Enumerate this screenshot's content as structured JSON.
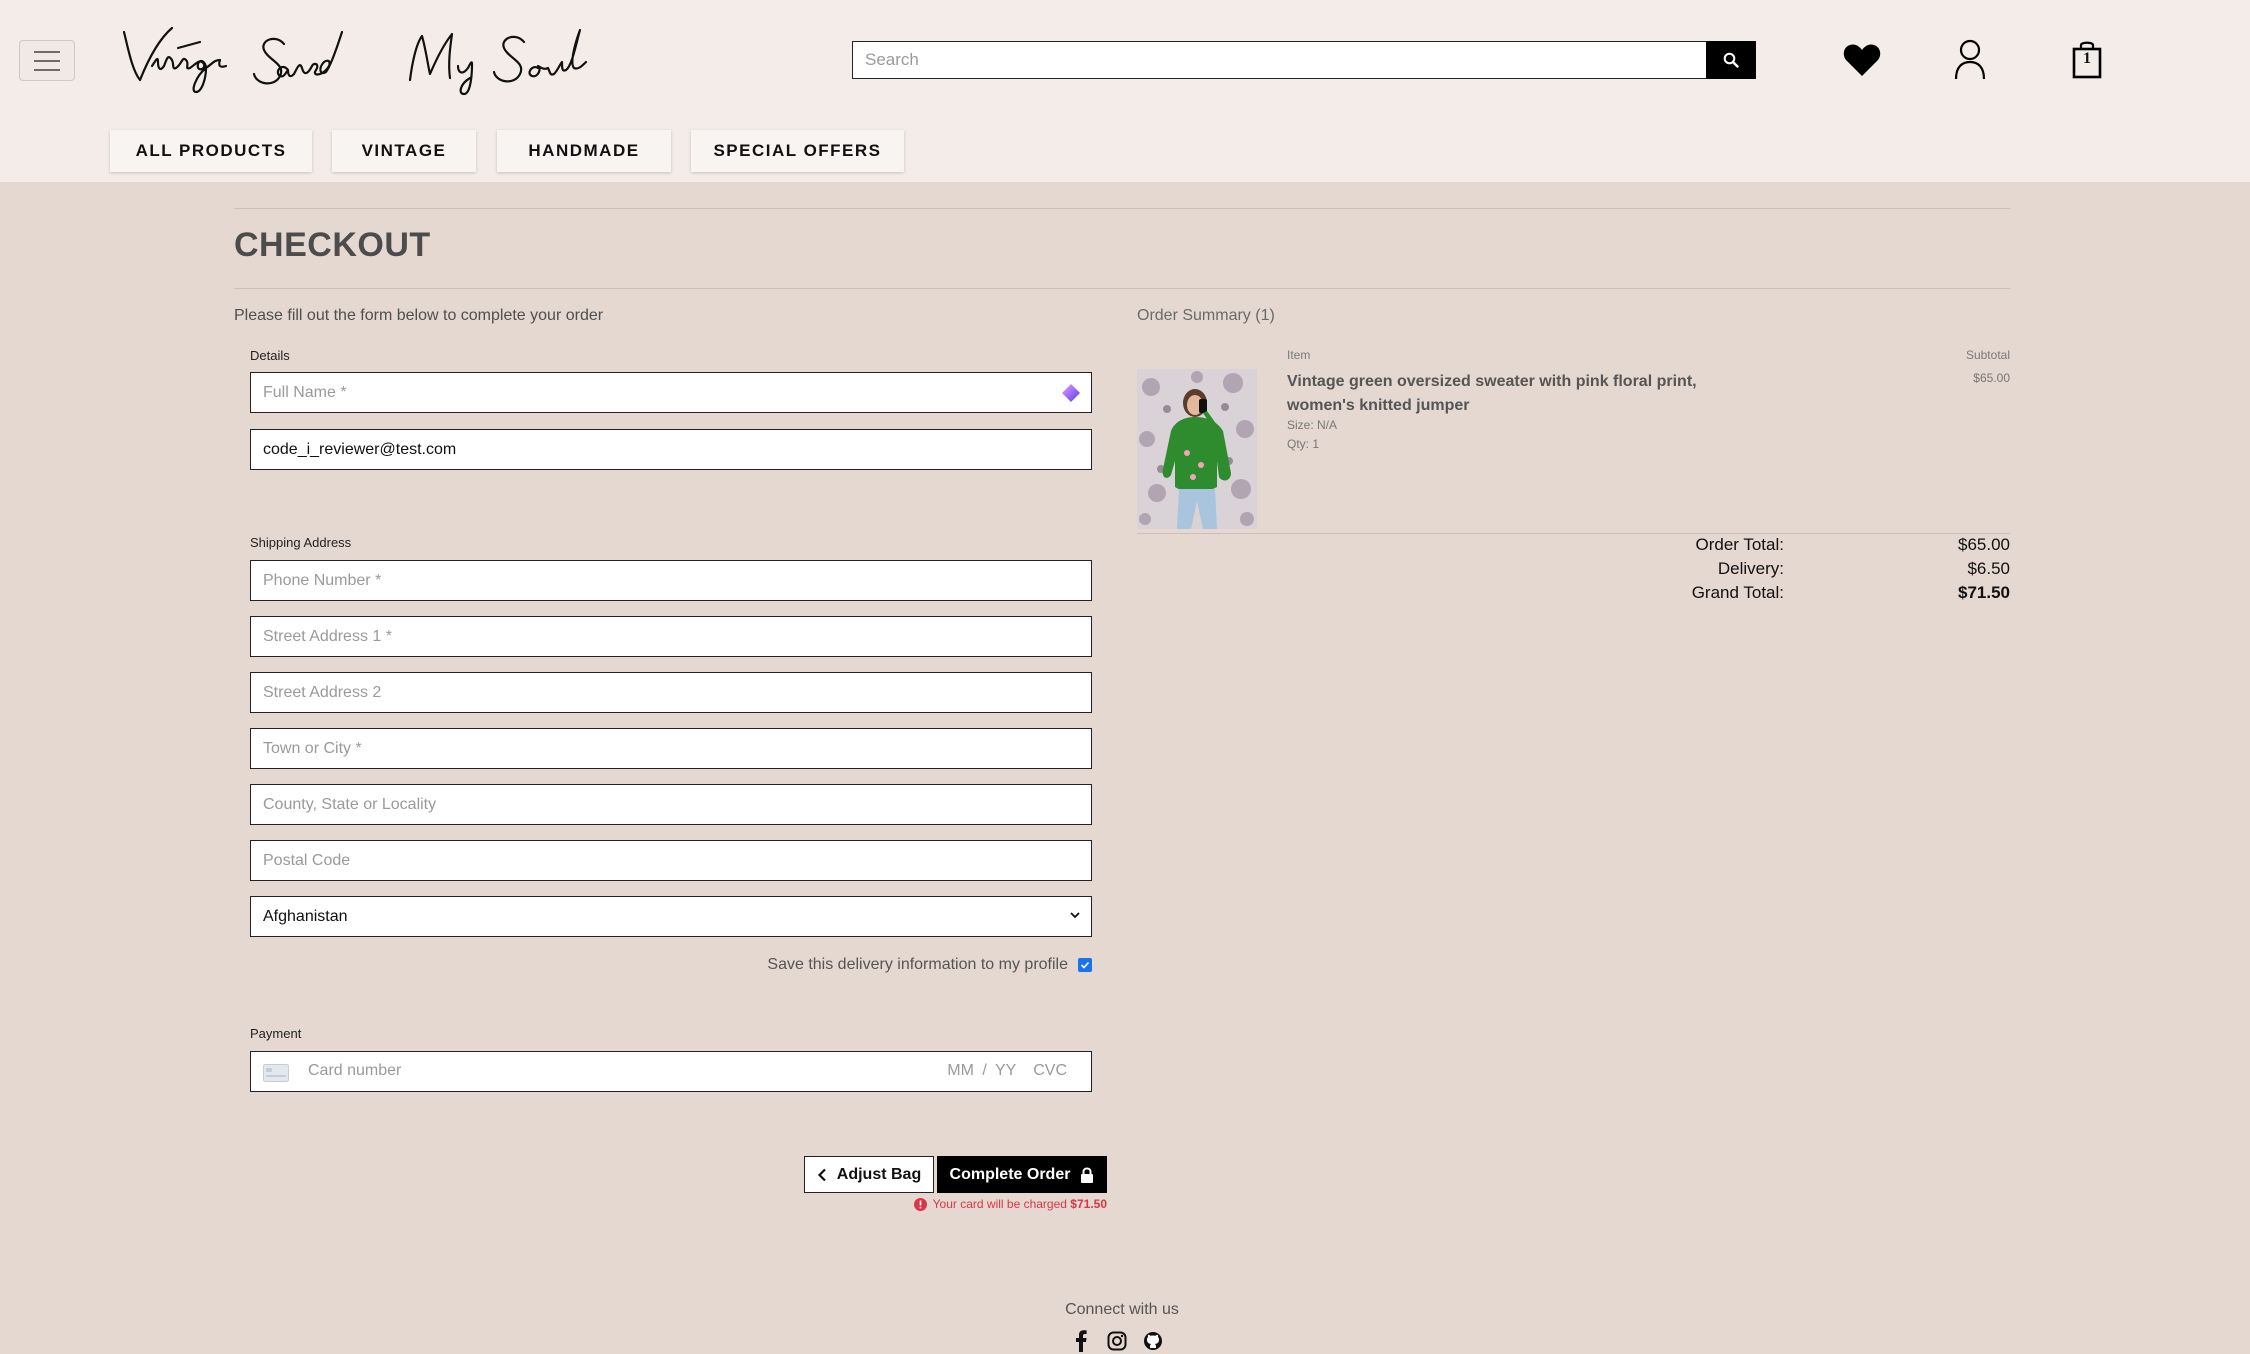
{
  "header": {
    "logo_text": "Vintage Saved My Soul",
    "search_placeholder": "Search",
    "bag_count": "1"
  },
  "nav": {
    "items": [
      {
        "label": "ALL PRODUCTS"
      },
      {
        "label": "VINTAGE"
      },
      {
        "label": "HANDMADE"
      },
      {
        "label": "SPECIAL OFFERS"
      }
    ]
  },
  "page": {
    "title": "CHECKOUT",
    "lead": "Please fill out the form below to complete your order"
  },
  "form": {
    "details_label": "Details",
    "full_name_placeholder": "Full Name *",
    "email_value": "code_i_reviewer@test.com",
    "shipping_label": "Shipping Address",
    "phone_placeholder": "Phone Number *",
    "street1_placeholder": "Street Address 1 *",
    "street2_placeholder": "Street Address 2",
    "town_placeholder": "Town or City *",
    "county_placeholder": "County, State or Locality",
    "postcode_placeholder": "Postal Code",
    "country_value": "Afghanistan",
    "save_info_label": "Save this delivery information to my profile",
    "save_info_checked": true,
    "payment_label": "Payment",
    "card_number_placeholder": "Card number",
    "card_expiry_placeholder": "MM / YY",
    "card_cvc_placeholder": "CVC"
  },
  "actions": {
    "adjust_bag_label": "Adjust Bag",
    "complete_order_label": "Complete Order",
    "charge_note": "Your card will be charged",
    "charge_amount": "$71.50"
  },
  "summary": {
    "title": "Order Summary (1)",
    "item_header": "Item",
    "subtotal_header": "Subtotal",
    "item": {
      "name": "Vintage green oversized sweater with pink floral print, women's knitted jumper",
      "size": "Size: N/A",
      "qty": "Qty: 1",
      "subtotal": "$65.00"
    },
    "order_total_label": "Order Total:",
    "order_total_value": "$65.00",
    "delivery_label": "Delivery:",
    "delivery_value": "$6.50",
    "grand_total_label": "Grand Total:",
    "grand_total_value": "$71.50"
  },
  "footer": {
    "connect_label": "Connect with us",
    "icons": [
      "facebook-icon",
      "instagram-icon",
      "github-icon"
    ]
  },
  "colors": {
    "page_bg": "#e5d8d0",
    "header_bg": "#f3ece8",
    "error": "#dc3545",
    "checkbox": "#1a73e8"
  }
}
